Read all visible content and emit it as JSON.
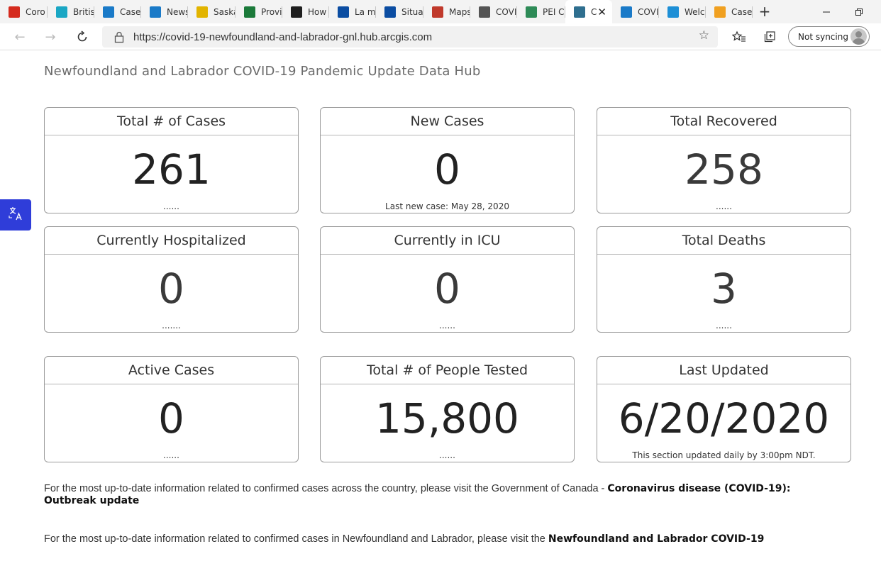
{
  "browser": {
    "tabs": [
      {
        "label": "Coro",
        "favicon": "maple-leaf-icon",
        "color": "#d52b1e"
      },
      {
        "label": "Britis",
        "favicon": "bc-icon",
        "color": "#1aa7c4"
      },
      {
        "label": "Cases",
        "favicon": "arcgis-icon",
        "color": "#1a7ac8"
      },
      {
        "label": "News",
        "favicon": "arcgis-icon",
        "color": "#1a7ac8"
      },
      {
        "label": "Saska",
        "favicon": "saskatchewan-icon",
        "color": "#e2b400"
      },
      {
        "label": "Provi",
        "favicon": "manitoba-icon",
        "color": "#1b7a3a"
      },
      {
        "label": "How",
        "favicon": "ontario-icon",
        "color": "#1f1f1f"
      },
      {
        "label": "La m",
        "favicon": "quebec-icon",
        "color": "#0b4da2"
      },
      {
        "label": "Situat",
        "favicon": "quebec-icon",
        "color": "#0b4da2"
      },
      {
        "label": "Maps",
        "favicon": "maps-icon",
        "color": "#c0392b"
      },
      {
        "label": "COVI",
        "favicon": "nb-icon",
        "color": "#555555"
      },
      {
        "label": "PEI C",
        "favicon": "pei-icon",
        "color": "#2e8b57"
      },
      {
        "label": "C",
        "favicon": "nl-icon",
        "color": "#2f6f8f"
      },
      {
        "label": "COVI",
        "favicon": "ns-icon",
        "color": "#1a7ac8"
      },
      {
        "label": "Welc",
        "favicon": "yukon-icon",
        "color": "#1d8fd6"
      },
      {
        "label": "Case",
        "favicon": "nwt-icon",
        "color": "#f0a020"
      }
    ],
    "active_tab_index": 12,
    "url": "https://covid-19-newfoundland-and-labrador-gnl.hub.arcgis.com",
    "sync_label": "Not syncing"
  },
  "page": {
    "title": "Newfoundland and Labrador COVID-19 Pandemic Update Data Hub",
    "cards": [
      {
        "title": "Total # of Cases",
        "value": "261",
        "footer": "......"
      },
      {
        "title": "New Cases",
        "value": "0",
        "footer": "Last new case: May 28, 2020"
      },
      {
        "title": "Total Recovered",
        "value": "258",
        "footer": "......"
      },
      {
        "title": "Currently Hospitalized",
        "value": "0",
        "footer": "......."
      },
      {
        "title": "Currently in ICU",
        "value": "0",
        "footer": "......"
      },
      {
        "title": "Total Deaths",
        "value": "3",
        "footer": "......"
      },
      {
        "title": "Active Cases",
        "value": "0",
        "footer": "......"
      },
      {
        "title": "Total # of People Tested",
        "value": "15,800",
        "footer": "......"
      },
      {
        "title": "Last Updated",
        "value": "6/20/2020",
        "footer": "This section updated daily by 3:00pm NDT."
      }
    ],
    "para1": {
      "text": "For the most up-to-date information related to confirmed cases across the country, please visit the Government of Canada - ",
      "link": "Coronavirus disease (COVID-19): Outbreak update"
    },
    "para2": {
      "text": "For the most up-to-date information related to confirmed cases in Newfoundland and Labrador, please visit the ",
      "link": "Newfoundland and Labrador COVID-19"
    }
  }
}
